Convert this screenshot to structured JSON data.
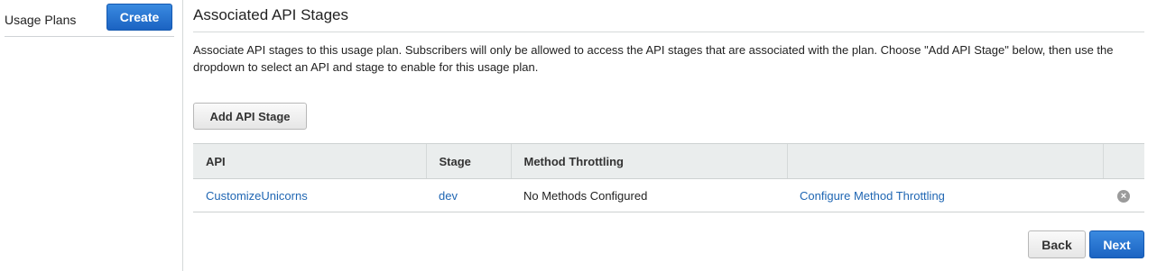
{
  "sidebar": {
    "title": "Usage Plans",
    "create_label": "Create"
  },
  "main": {
    "section_title": "Associated API Stages",
    "description": "Associate API stages to this usage plan. Subscribers will only be allowed to access the API stages that are associated with the plan. Choose \"Add API Stage\" below, then use the dropdown to select an API and stage to enable for this usage plan.",
    "add_stage_label": "Add API Stage",
    "table": {
      "headers": [
        "API",
        "Stage",
        "Method Throttling",
        "",
        ""
      ],
      "rows": [
        {
          "api": "CustomizeUnicorns",
          "stage": "dev",
          "throttling": "No Methods Configured",
          "configure_link": "Configure Method Throttling",
          "remove_icon": "remove-circle-icon"
        }
      ]
    },
    "back_label": "Back",
    "next_label": "Next"
  },
  "colors": {
    "primary": "#1b63c2",
    "link": "#1f66b3",
    "header_bg": "#eaeded"
  }
}
